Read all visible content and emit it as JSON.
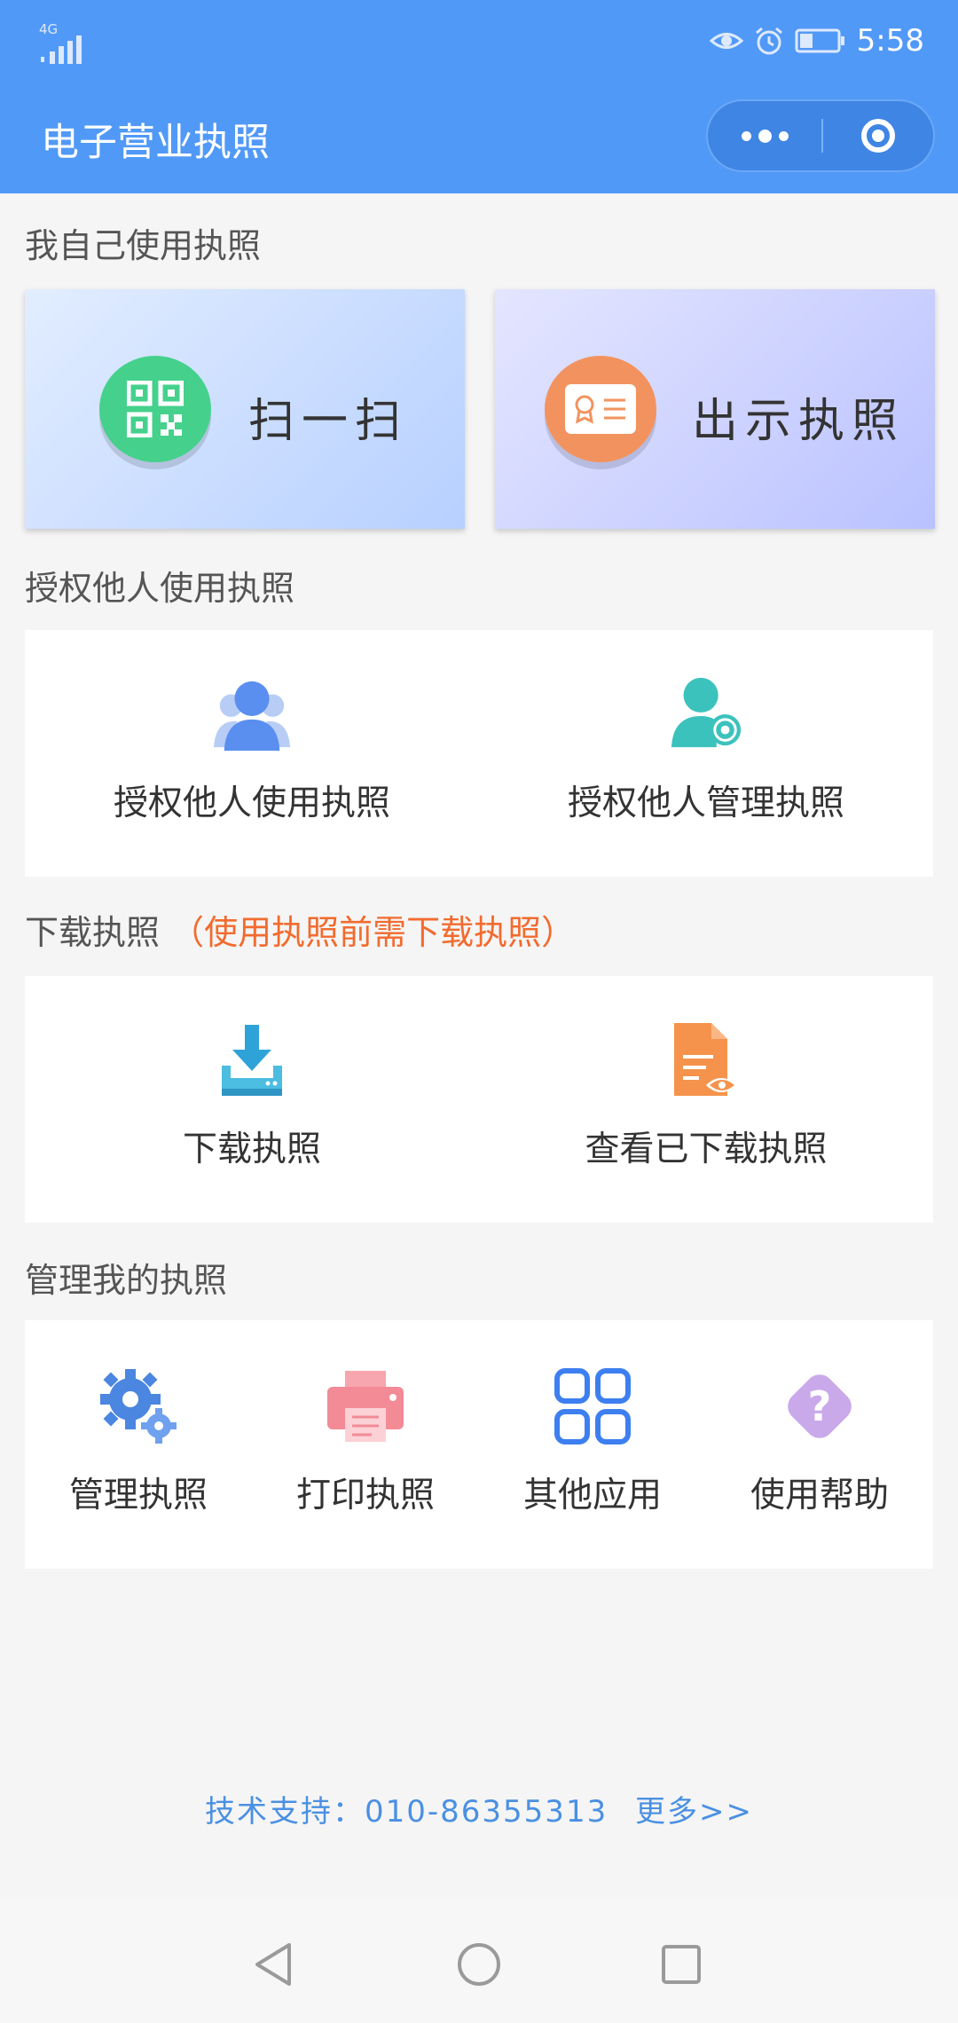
{
  "status_bar": {
    "network": "4G",
    "time": "5:58"
  },
  "header": {
    "title": "电子营业执照"
  },
  "sections": {
    "self_use": "我自己使用执照",
    "authorize": "授权他人使用执照",
    "download": "下载执照",
    "download_note": "（使用执照前需下载执照）",
    "manage": "管理我的执照"
  },
  "cards": {
    "scan": "扫一扫",
    "show": "出示执照"
  },
  "authorize_items": [
    {
      "label": "授权他人使用执照",
      "icon": "users-icon"
    },
    {
      "label": "授权他人管理执照",
      "icon": "user-gear-icon"
    }
  ],
  "download_items": [
    {
      "label": "下载执照",
      "icon": "download-icon"
    },
    {
      "label": "查看已下载执照",
      "icon": "document-view-icon"
    }
  ],
  "manage_items": [
    {
      "label": "管理执照",
      "icon": "gears-icon"
    },
    {
      "label": "打印执照",
      "icon": "printer-icon"
    },
    {
      "label": "其他应用",
      "icon": "apps-grid-icon"
    },
    {
      "label": "使用帮助",
      "icon": "help-icon"
    }
  ],
  "footer": {
    "support": "技术支持：010-86355313",
    "more": "更多>>"
  },
  "colors": {
    "header": "#5199f7",
    "accent_orange": "#f26b2e",
    "link_blue": "#4a90e2",
    "scan_green": "#45d18c",
    "show_orange": "#f2935f"
  }
}
